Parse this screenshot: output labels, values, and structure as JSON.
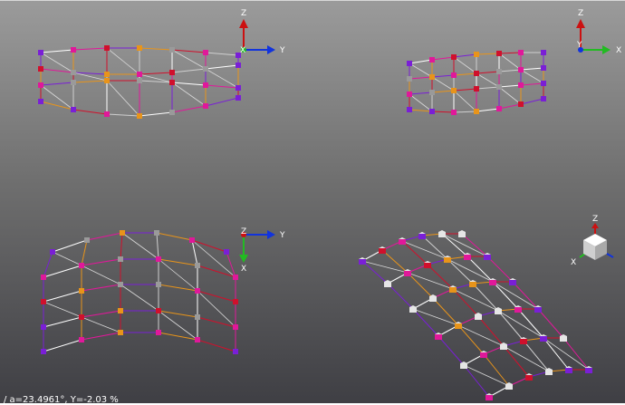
{
  "viewports": {
    "top_left": {
      "gizmo_labels": {
        "up": "Z",
        "center": "X",
        "right": "Y"
      }
    },
    "top_right": {
      "gizmo_labels": {
        "up": "Z",
        "center": "Y",
        "right": "X"
      }
    },
    "bottom_left": {
      "gizmo_labels": {
        "up": "Z",
        "down": "X",
        "right": "Y"
      }
    },
    "bottom_right": {
      "gizmo_labels": {
        "up": "Z",
        "left": "X"
      }
    }
  },
  "colors": {
    "background_top": "#9b9b9b",
    "background_bottom": "#3f3f44",
    "axis_z": "#cc1111",
    "axis_y": "#1133dd",
    "axis_x": "#22bb22",
    "node_purple": "#7a1fd6",
    "node_magenta": "#e0189a",
    "node_red": "#d0102c",
    "node_orange": "#e8941a",
    "node_gray": "#9a9a9a",
    "node_white": "#e6e6e6"
  },
  "status_bar": {
    "text": "/ a=23.4961°, Y=-2.03 %"
  }
}
